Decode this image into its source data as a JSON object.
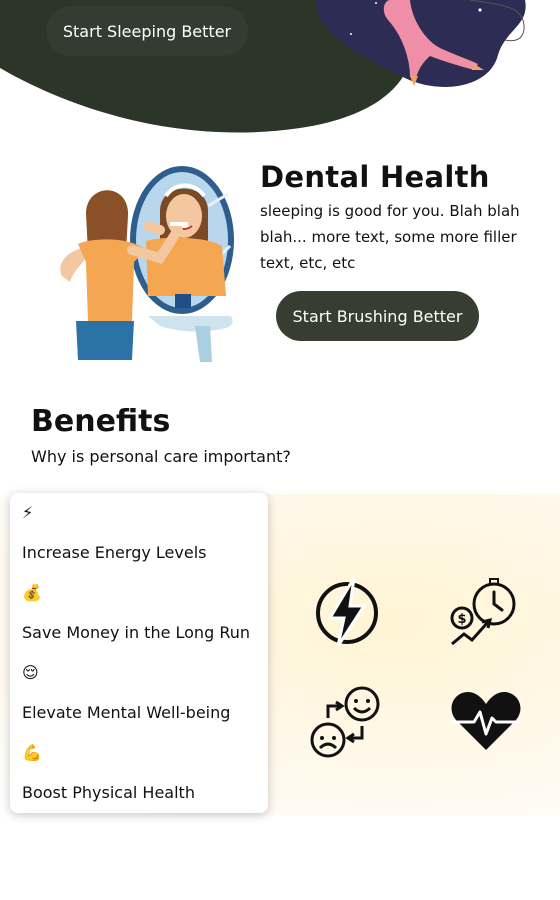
{
  "hero": {
    "button_label": "Start Sleeping Better",
    "blob_color": "#2c3628",
    "night_color": "#2d2c55",
    "accent_pink": "#ee8fa7"
  },
  "dental": {
    "title": "Dental Health",
    "text": "sleeping is good for you. Blah blah blah... more text, some more filler text, etc, etc",
    "button_label": "Start Brushing Better",
    "illustration_icon": "girl-brushing-teeth-mirror-illustration"
  },
  "benefits": {
    "title": "Benefits",
    "subtitle": "Why is personal care important?",
    "items": [
      {
        "emoji": "⚡",
        "label": "Increase Energy Levels"
      },
      {
        "emoji": "💰",
        "label": "Save Money in the Long Run"
      },
      {
        "emoji": "😌",
        "label": "Elevate Mental Well-being"
      },
      {
        "emoji": "💪",
        "label": "Boost Physical Health"
      }
    ],
    "icons": [
      "lightning-icon",
      "money-growth-icon",
      "mood-swap-icon",
      "heartbeat-icon"
    ]
  }
}
